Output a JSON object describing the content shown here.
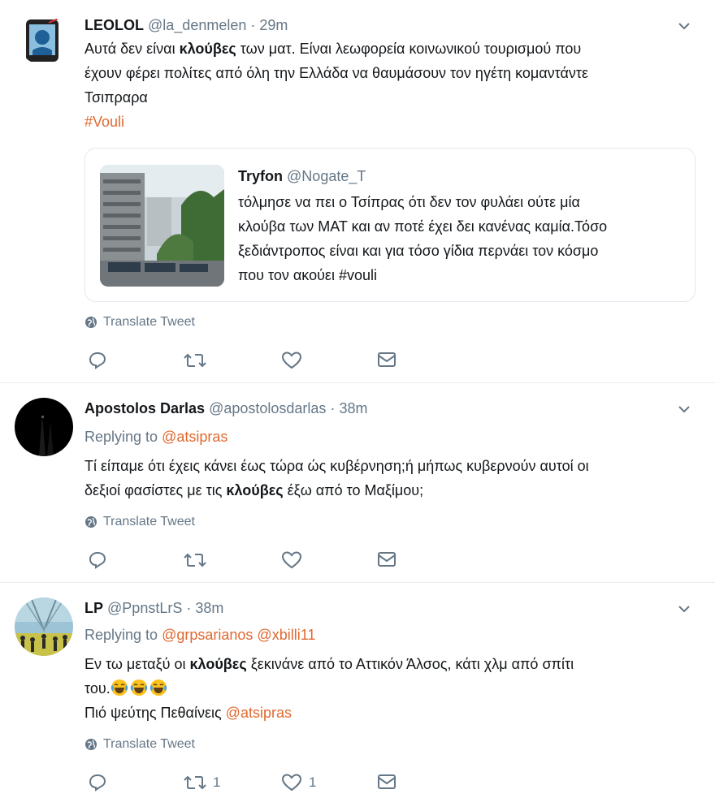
{
  "tweets": [
    {
      "name": "LEOLOL",
      "handle": "@la_denmelen",
      "dot": "·",
      "time": "29m",
      "body_lines": [
        [
          "Αυτά δεν είναι ",
          "κλούβες",
          " των ματ. Είναι λεωφορεία κοινωνικού τουρισμού που"
        ],
        "έχουν φέρει πολίτες από όλη την Ελλάδα να θαυμάσουν τον ηγέτη κομαντάντε",
        "Τσιπραρα"
      ],
      "hashtag": "#Vouli",
      "quote": {
        "name": "Tryfon",
        "handle": "@Nogate_T",
        "lines": [
          "τόλμησε να πει ο Τσίπρας ότι δεν τον φυλάει ούτε μία",
          "κλούβα των ΜΑΤ και αν ποτέ έχει δει κανένας καμία.Τόσο",
          "ξεδιάντροπος είναι και για τόσο γίδια περνάει τον κόσμο",
          "που τον ακούει #vouli"
        ]
      },
      "translate": "Translate Tweet",
      "retweets": "",
      "likes": ""
    },
    {
      "name": "Apostolos Darlas",
      "handle": "@apostolosdarlas",
      "dot": "·",
      "time": "38m",
      "replying_prefix": "Replying to",
      "replying_to": [
        "@atsipras"
      ],
      "body_lines": [
        "Τί είπαμε ότι έχεις κάνει έως τώρα ώς κυβέρνηση;ή μήπως κυβερνούν αυτοί οι",
        [
          "δεξιοί φασίστες με τις ",
          "κλούβες",
          " έξω από το Μαξίμου;"
        ]
      ],
      "translate": "Translate Tweet",
      "retweets": "",
      "likes": ""
    },
    {
      "name": "LP",
      "handle": "@PpnstLrS",
      "dot": "·",
      "time": "38m",
      "replying_prefix": "Replying to",
      "replying_to": [
        "@grpsarianos",
        "@xbilli11"
      ],
      "body_lines": [
        [
          "Εν τω μεταξύ οι ",
          "κλούβες",
          " ξεκινάνε από το Αττικόν Άλσος, κάτι χλμ από σπίτι"
        ],
        "του."
      ],
      "emoji": "laughing-tears",
      "last_line_prefix": "Πιό ψεύτης Πεθαίνεις",
      "last_line_mention": "@atsipras",
      "translate": "Translate Tweet",
      "retweets": "1",
      "likes": "1"
    }
  ],
  "colors": {
    "link": "#e0692f",
    "muted": "#657786",
    "text": "#14171a",
    "border": "#e1e8ed"
  },
  "icons": [
    "reply-icon",
    "retweet-icon",
    "like-icon",
    "message-icon",
    "globe-icon",
    "chevron-down-icon"
  ]
}
